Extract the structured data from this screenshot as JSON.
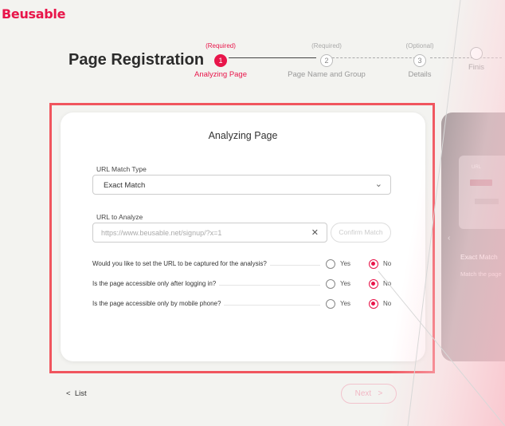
{
  "brand": {
    "logo_text": "Beusable",
    "accent": "#e8154a"
  },
  "page_title": "Page Registration",
  "steps": [
    {
      "requirement": "(Required)",
      "number": "1",
      "label": "Analyzing Page",
      "active": true
    },
    {
      "requirement": "(Required)",
      "number": "2",
      "label": "Page Name and Group",
      "active": false
    },
    {
      "requirement": "(Optional)",
      "number": "3",
      "label": "Details",
      "active": false
    },
    {
      "requirement": "",
      "number": "",
      "label": "Finis",
      "active": false
    }
  ],
  "card": {
    "title": "Analyzing Page",
    "match_type": {
      "label": "URL Match Type",
      "value": "Exact Match",
      "icon": "chevron-down-icon"
    },
    "url": {
      "label": "URL to Analyze",
      "placeholder": "https://www.beusable.net/signup/?x=1",
      "clear_icon": "close-icon",
      "confirm_label": "Confirm Match"
    },
    "questions": [
      {
        "text": "Would you like to set the URL to be captured for the analysis?",
        "yes": "Yes",
        "no": "No",
        "selected": "No"
      },
      {
        "text": "Is the page accessible only after logging in?",
        "yes": "Yes",
        "no": "No",
        "selected": "No"
      },
      {
        "text": "Is the page accessible only by mobile phone?",
        "yes": "Yes",
        "no": "No",
        "selected": "No"
      }
    ]
  },
  "preview": {
    "url_label": "URL",
    "title": "Exact Match",
    "description": "Match the page"
  },
  "footer": {
    "list_label": "List",
    "next_label": "Next"
  }
}
